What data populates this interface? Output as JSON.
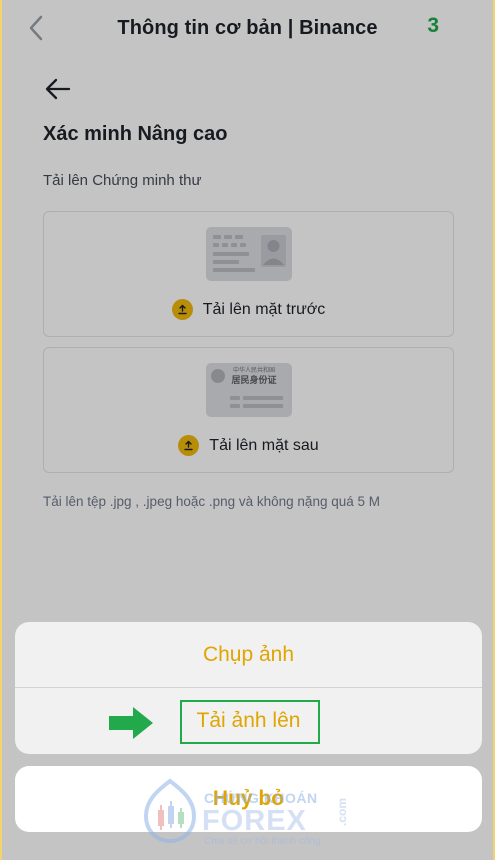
{
  "navbar": {
    "title": "Thông tin cơ bản | Binance",
    "step_badge": "3"
  },
  "page": {
    "title": "Xác minh Nâng cao",
    "section_label": "Tải lên Chứng minh thư",
    "front_upload_label": "Tải lên mặt trước",
    "back_upload_label": "Tải lên mặt sau",
    "id_card_back_header": "中华人民共和国",
    "id_card_back_title": "居民身份证",
    "hint": "Tải lên tệp .jpg , .jpeg hoặc .png và không nặng quá 5 M"
  },
  "action_sheet": {
    "option_camera": "Chụp ảnh",
    "option_upload": "Tải ảnh lên",
    "cancel": "Huỷ bỏ"
  },
  "watermark": {
    "top": "CHỨNG KHOÁN",
    "main": "FOREX",
    "com": ".com",
    "tagline": "Chia sẻ cơ hội thành công"
  },
  "colors": {
    "accent": "#F0B90B",
    "sheet_text": "#E0A500",
    "annotation_green": "#21A94C"
  }
}
